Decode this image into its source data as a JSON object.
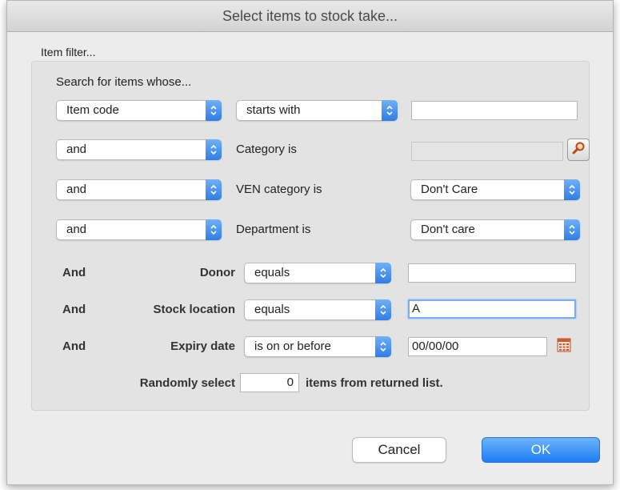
{
  "dialog": {
    "title": "Select items to stock take...",
    "legend": "Item filter..."
  },
  "filter": {
    "heading": "Search for items whose...",
    "row1": {
      "field": "Item code",
      "operator": "starts with",
      "value": ""
    },
    "row2": {
      "conj": "and",
      "label": "Category is",
      "value": ""
    },
    "row3": {
      "conj": "and",
      "label": "VEN category is",
      "value": "Don't Care"
    },
    "row4": {
      "conj": "and",
      "label": "Department is",
      "value": "Don't care"
    },
    "donor": {
      "conj": "And",
      "label": "Donor",
      "operator": "equals",
      "value": ""
    },
    "location": {
      "conj": "And",
      "label": "Stock location",
      "operator": "equals",
      "value": "A"
    },
    "expiry": {
      "conj": "And",
      "label": "Expiry date",
      "operator": "is on or before",
      "value": "00/00/00"
    },
    "random": {
      "prefix": "Randomly select",
      "count": "0",
      "suffix": "items from returned list."
    }
  },
  "buttons": {
    "cancel": "Cancel",
    "ok": "OK"
  },
  "icons": {
    "search": "magnifier-icon",
    "calendar": "calendar-icon",
    "popup_arrows": "chevron-updown-icon"
  },
  "colors": {
    "accent": "#2f7de6",
    "ok_button": "#1c7ef5"
  }
}
